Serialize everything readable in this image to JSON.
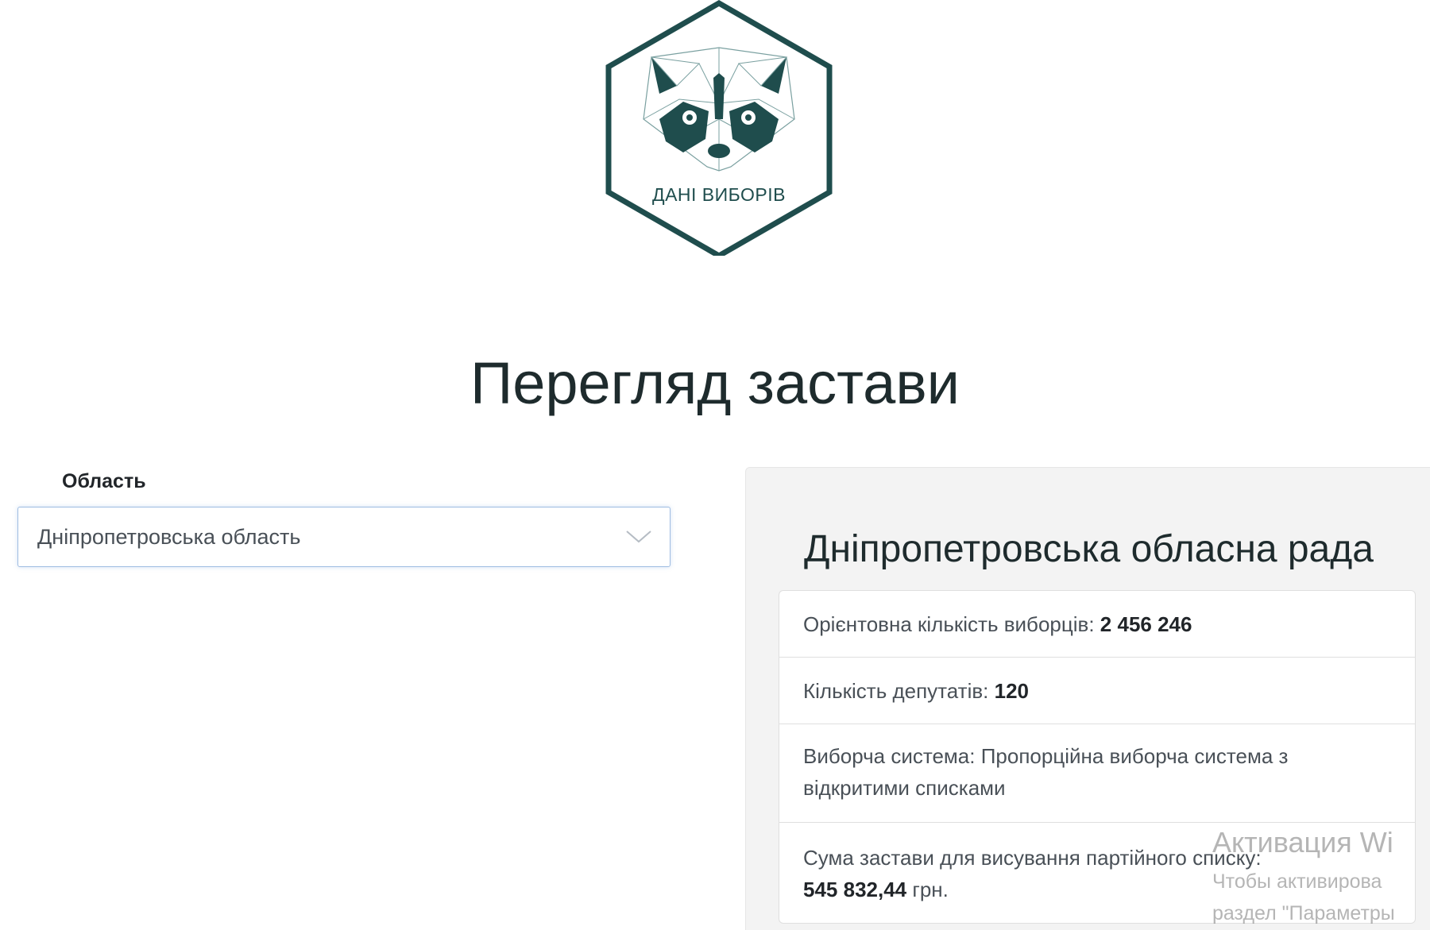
{
  "logo": {
    "text": "ДАНІ ВИБОРІВ",
    "icon": "raccoon-icon",
    "color": "#1f4d4d"
  },
  "page": {
    "title": "Перегляд застави"
  },
  "region": {
    "label": "Область",
    "selected": "Дніпропетровська область"
  },
  "council": {
    "title": "Дніпропетровська обласна рада",
    "voters_label": "Орієнтовна кількість виборців: ",
    "voters_value": "2 456 246",
    "deputies_label": "Кількість депутатів: ",
    "deputies_value": "120",
    "system_label": "Виборча система: ",
    "system_value": "Пропорційна виборча система з відкритими списками",
    "deposit_label": "Сума застави для висування партійного списку:",
    "deposit_value": "545 832,44",
    "deposit_unit": " грн."
  },
  "watermark": {
    "title": "Активация Wi",
    "line1": "Чтобы активирова",
    "line2": "раздел \"Параметры"
  }
}
